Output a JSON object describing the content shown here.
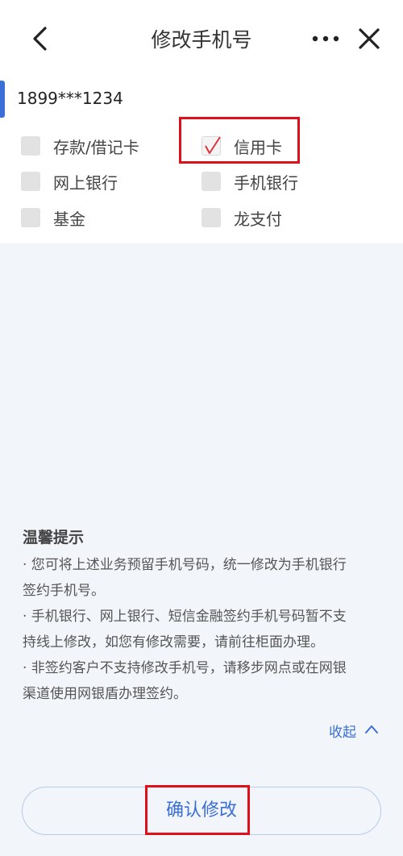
{
  "header": {
    "title": "修改手机号",
    "back_icon": "chevron-left-icon",
    "more_icon": "more-dots-icon",
    "close_icon": "close-icon"
  },
  "account": {
    "phone": "1899***1234"
  },
  "options": [
    {
      "label": "存款/借记卡",
      "checked": false
    },
    {
      "label": "信用卡",
      "checked": true
    },
    {
      "label": "网上银行",
      "checked": false
    },
    {
      "label": "手机银行",
      "checked": false
    },
    {
      "label": "基金",
      "checked": false
    },
    {
      "label": "龙支付",
      "checked": false
    }
  ],
  "tips": {
    "title": "温馨提示",
    "lines": [
      "· 您可将上述业务预留手机号码，统一修改为手机银行",
      "签约手机号。",
      "· 手机银行、网上银行、短信金融签约手机号码暂不支",
      "持线上修改，如您有修改需要，请前往柜面办理。",
      "· 非签约客户不支持修改手机号，请移步网点或在网银",
      "渠道使用网银盾办理签约。"
    ],
    "collapse_label": "收起"
  },
  "confirm": {
    "label": "确认修改"
  },
  "colors": {
    "accent": "#3a6fd8",
    "highlight": "#e0101a",
    "check": "#e0303a",
    "background": "#f2f5f9"
  }
}
